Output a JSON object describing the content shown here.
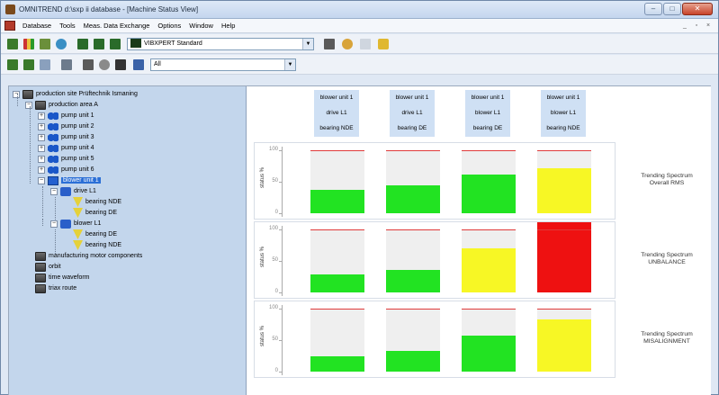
{
  "window": {
    "title": "OMNITREND d:\\sxp ii database - [Machine Status View]",
    "controls": [
      "–",
      "□",
      "✕"
    ]
  },
  "menu": {
    "items": [
      "Database",
      "Tools",
      "Meas. Data Exchange",
      "Options",
      "Window",
      "Help"
    ],
    "mdi_controls": [
      "_",
      "▫",
      "×"
    ]
  },
  "toolbar1": {
    "device_combo": "VIBXPERT Standard",
    "icons": [
      "tree-icon",
      "bar-chart-icon",
      "station-icon",
      "refresh-icon",
      "device-icon",
      "device-icon",
      "device-icon",
      "book-icon",
      "key-icon",
      "disabled-icon",
      "help-icon"
    ]
  },
  "toolbar2": {
    "filter_combo": "All",
    "icons": [
      "tree-expand-icon",
      "tree-collapse-icon",
      "arrow-icon",
      "split-icon",
      "percent-icon",
      "eye-icon",
      "lock-icon",
      "table-icon"
    ]
  },
  "tree": {
    "nodes": [
      {
        "label": "production site Prüftechnik Ismaning",
        "icon": "folder",
        "expander": "−",
        "level": 0
      },
      {
        "label": "production area A",
        "icon": "folder",
        "expander": "−",
        "level": 1
      },
      {
        "label": "pump unit 1",
        "icon": "pump",
        "expander": "+",
        "level": 2
      },
      {
        "label": "pump unit 2",
        "icon": "pump",
        "expander": "+",
        "level": 2
      },
      {
        "label": "pump unit 3",
        "icon": "pump",
        "expander": "+",
        "level": 2
      },
      {
        "label": "pump unit 4",
        "icon": "pump",
        "expander": "+",
        "level": 2
      },
      {
        "label": "pump unit 5",
        "icon": "pump",
        "expander": "+",
        "level": 2
      },
      {
        "label": "pump unit 6",
        "icon": "pump",
        "expander": "+",
        "level": 2
      },
      {
        "label": "blower unit 1",
        "icon": "blower",
        "expander": "−",
        "level": 2,
        "selected": true
      },
      {
        "label": "drive L1",
        "icon": "drive",
        "expander": "−",
        "level": 3
      },
      {
        "label": "bearing NDE",
        "icon": "bearing",
        "expander": "",
        "level": 4
      },
      {
        "label": "bearing DE",
        "icon": "bearing",
        "expander": "",
        "level": 4
      },
      {
        "label": "blower L1",
        "icon": "drive",
        "expander": "−",
        "level": 3
      },
      {
        "label": "bearing DE",
        "icon": "bearing",
        "expander": "",
        "level": 4
      },
      {
        "label": "bearing NDE",
        "icon": "bearing",
        "expander": "",
        "level": 4
      },
      {
        "label": "manufacturing motor components",
        "icon": "folder",
        "expander": "",
        "level": 1
      },
      {
        "label": "orbit",
        "icon": "folder",
        "expander": "",
        "level": 1
      },
      {
        "label": "time waveform",
        "icon": "folder",
        "expander": "",
        "level": 1
      },
      {
        "label": "triax route",
        "icon": "folder",
        "expander": "",
        "level": 1
      }
    ]
  },
  "columns": [
    {
      "line1": "blower unit 1",
      "line2": "drive L1",
      "line3": "bearing NDE"
    },
    {
      "line1": "blower unit 1",
      "line2": "drive L1",
      "line3": "bearing DE"
    },
    {
      "line1": "blower unit 1",
      "line2": "blower L1",
      "line3": "bearing DE"
    },
    {
      "line1": "blower unit 1",
      "line2": "blower L1",
      "line3": "bearing NDE"
    }
  ],
  "colors": {
    "green": "#22e322",
    "yellow": "#f7f725",
    "red": "#ee1111",
    "limit": "#e03a3a"
  },
  "chart_data": [
    {
      "type": "bar",
      "label_line1": "Trending Spectrum",
      "label_line2": "Overall RMS",
      "ylabel": "status %",
      "ylim": [
        0,
        100
      ],
      "ticks": [
        "100",
        "50",
        "0"
      ],
      "limit": 100,
      "values": [
        37,
        45,
        62,
        72
      ],
      "statuses": [
        "green",
        "green",
        "green",
        "yellow"
      ]
    },
    {
      "type": "bar",
      "label_line1": "Trending Spectrum",
      "label_line2": "UNBALANCE",
      "ylabel": "status %",
      "ylim": [
        0,
        100
      ],
      "ticks": [
        "100",
        "50",
        "0"
      ],
      "limit": 100,
      "values": [
        28,
        36,
        70,
        112
      ],
      "statuses": [
        "green",
        "green",
        "yellow",
        "red"
      ]
    },
    {
      "type": "bar",
      "label_line1": "Trending Spectrum",
      "label_line2": "MISALIGNMENT",
      "ylabel": "status %",
      "ylim": [
        0,
        100
      ],
      "ticks": [
        "100",
        "50",
        "0"
      ],
      "limit": 100,
      "values": [
        24,
        33,
        57,
        83
      ],
      "statuses": [
        "green",
        "green",
        "green",
        "yellow"
      ]
    }
  ]
}
